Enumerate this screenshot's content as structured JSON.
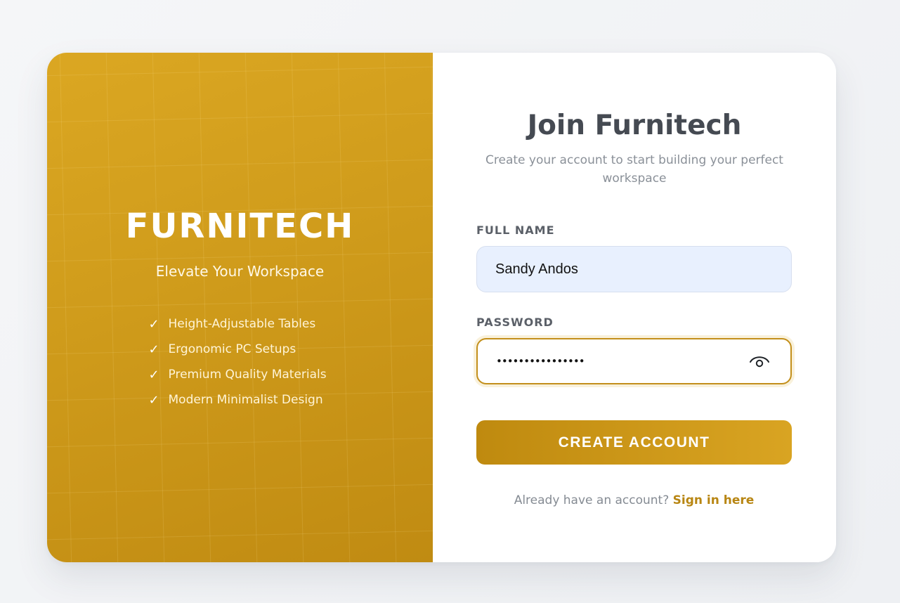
{
  "brand": {
    "name": "FURNITECH",
    "tagline": "Elevate Your Workspace",
    "features": [
      {
        "label": "Height-Adjustable Tables",
        "icon": "check-icon"
      },
      {
        "label": "Ergonomic PC Setups",
        "icon": "check-icon"
      },
      {
        "label": "Premium Quality Materials",
        "icon": "check-icon"
      },
      {
        "label": "Modern Minimalist Design",
        "icon": "check-icon"
      }
    ]
  },
  "form": {
    "title": "Join Furnitech",
    "subtitle": "Create your account to start building your perfect workspace",
    "full_name": {
      "label": "FULL NAME",
      "value": "Sandy Andos"
    },
    "password": {
      "label": "PASSWORD",
      "value": "••••••••••••••••",
      "toggle_icon": "eye-icon"
    },
    "submit_label": "CREATE ACCOUNT",
    "signin_prompt": "Already have an account?",
    "signin_link": "Sign in here"
  },
  "colors": {
    "accent": "#C99514",
    "brand_panel": "#D09C1C",
    "heading": "#454A52",
    "input_fill": "#E8F0FE"
  }
}
